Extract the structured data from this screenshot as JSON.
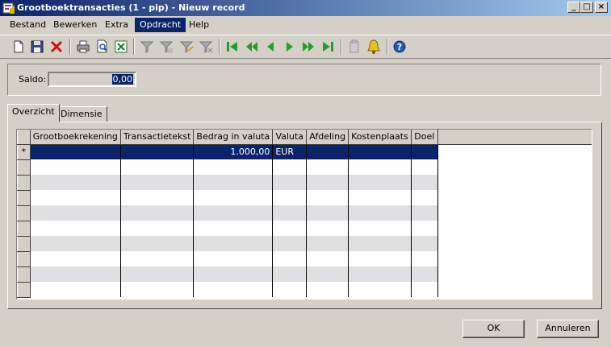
{
  "window": {
    "title": "Grootboektransacties (1 - pip) - Nieuw record",
    "minimize": "_",
    "maximize": "□",
    "close": "×"
  },
  "menu": {
    "items": [
      "Bestand",
      "Bewerken",
      "Extra",
      "Opdracht",
      "Help"
    ],
    "active": "Opdracht"
  },
  "toolbar": {
    "icons": [
      "new-icon",
      "save-icon",
      "delete-icon",
      "print-icon",
      "print-preview-icon",
      "excel-icon",
      "filter-icon",
      "filter-selection-icon",
      "advanced-filter-icon",
      "remove-filter-icon",
      "first-record-icon",
      "previous-page-icon",
      "previous-record-icon",
      "next-record-icon",
      "next-page-icon",
      "last-record-icon",
      "document-icon",
      "alert-icon",
      "help-icon"
    ]
  },
  "saldo": {
    "label": "Saldo:",
    "value": "0,00"
  },
  "tabs": [
    "Overzicht",
    "Dimensie"
  ],
  "grid": {
    "columns": [
      "Grootboekrekening",
      "Transactietekst",
      "Bedrag in valuta",
      "Valuta",
      "Afdeling",
      "Kostenplaats",
      "Doel"
    ],
    "rows": [
      {
        "marker": "*",
        "Grootboekrekening": "",
        "Transactietekst": "",
        "Bedrag in valuta": "1.000,00",
        "Valuta": "EUR",
        "Afdeling": "",
        "Kostenplaats": "",
        "Doel": ""
      }
    ],
    "empty_rows": 9
  },
  "buttons": {
    "ok": "OK",
    "cancel": "Annuleren"
  },
  "colors": {
    "titlebar": "#0a246a",
    "selection": "#0a246a",
    "face": "#d4d0c8"
  }
}
